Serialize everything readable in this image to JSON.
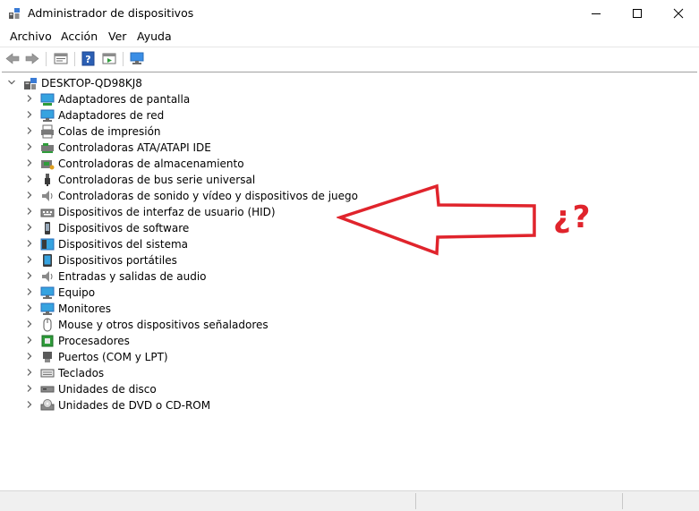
{
  "window": {
    "title": "Administrador de dispositivos",
    "app_icon": "device-manager-icon"
  },
  "menu": {
    "items": [
      "Archivo",
      "Acción",
      "Ver",
      "Ayuda"
    ]
  },
  "toolbar": {
    "icons": [
      "back-icon",
      "forward-icon",
      "properties-icon",
      "help-icon",
      "update-driver-icon",
      "scan-hardware-icon"
    ]
  },
  "tree": {
    "root": "DESKTOP-QD98KJ8",
    "categories": [
      {
        "label": "Adaptadores de pantalla",
        "icon": "display-adapter-icon"
      },
      {
        "label": "Adaptadores de red",
        "icon": "network-adapter-icon"
      },
      {
        "label": "Colas de impresión",
        "icon": "print-queue-icon"
      },
      {
        "label": "Controladoras ATA/ATAPI IDE",
        "icon": "ide-controller-icon"
      },
      {
        "label": "Controladoras de almacenamiento",
        "icon": "storage-controller-icon"
      },
      {
        "label": "Controladoras de bus serie universal",
        "icon": "usb-icon"
      },
      {
        "label": "Controladoras de sonido y vídeo y dispositivos de juego",
        "icon": "speaker-icon"
      },
      {
        "label": "Dispositivos de interfaz de usuario (HID)",
        "icon": "hid-icon"
      },
      {
        "label": "Dispositivos de software",
        "icon": "software-device-icon"
      },
      {
        "label": "Dispositivos del sistema",
        "icon": "system-device-icon"
      },
      {
        "label": "Dispositivos portátiles",
        "icon": "portable-device-icon"
      },
      {
        "label": "Entradas y salidas de audio",
        "icon": "audio-io-icon"
      },
      {
        "label": "Equipo",
        "icon": "computer-icon"
      },
      {
        "label": "Monitores",
        "icon": "monitor-icon"
      },
      {
        "label": "Mouse y otros dispositivos señaladores",
        "icon": "mouse-icon"
      },
      {
        "label": "Procesadores",
        "icon": "processor-icon"
      },
      {
        "label": "Puertos (COM y LPT)",
        "icon": "port-icon"
      },
      {
        "label": "Teclados",
        "icon": "keyboard-icon"
      },
      {
        "label": "Unidades de disco",
        "icon": "disk-drive-icon"
      },
      {
        "label": "Unidades de DVD o CD-ROM",
        "icon": "dvd-icon"
      }
    ]
  },
  "annotation": {
    "mark": "¿?",
    "color": "#e0242c"
  }
}
